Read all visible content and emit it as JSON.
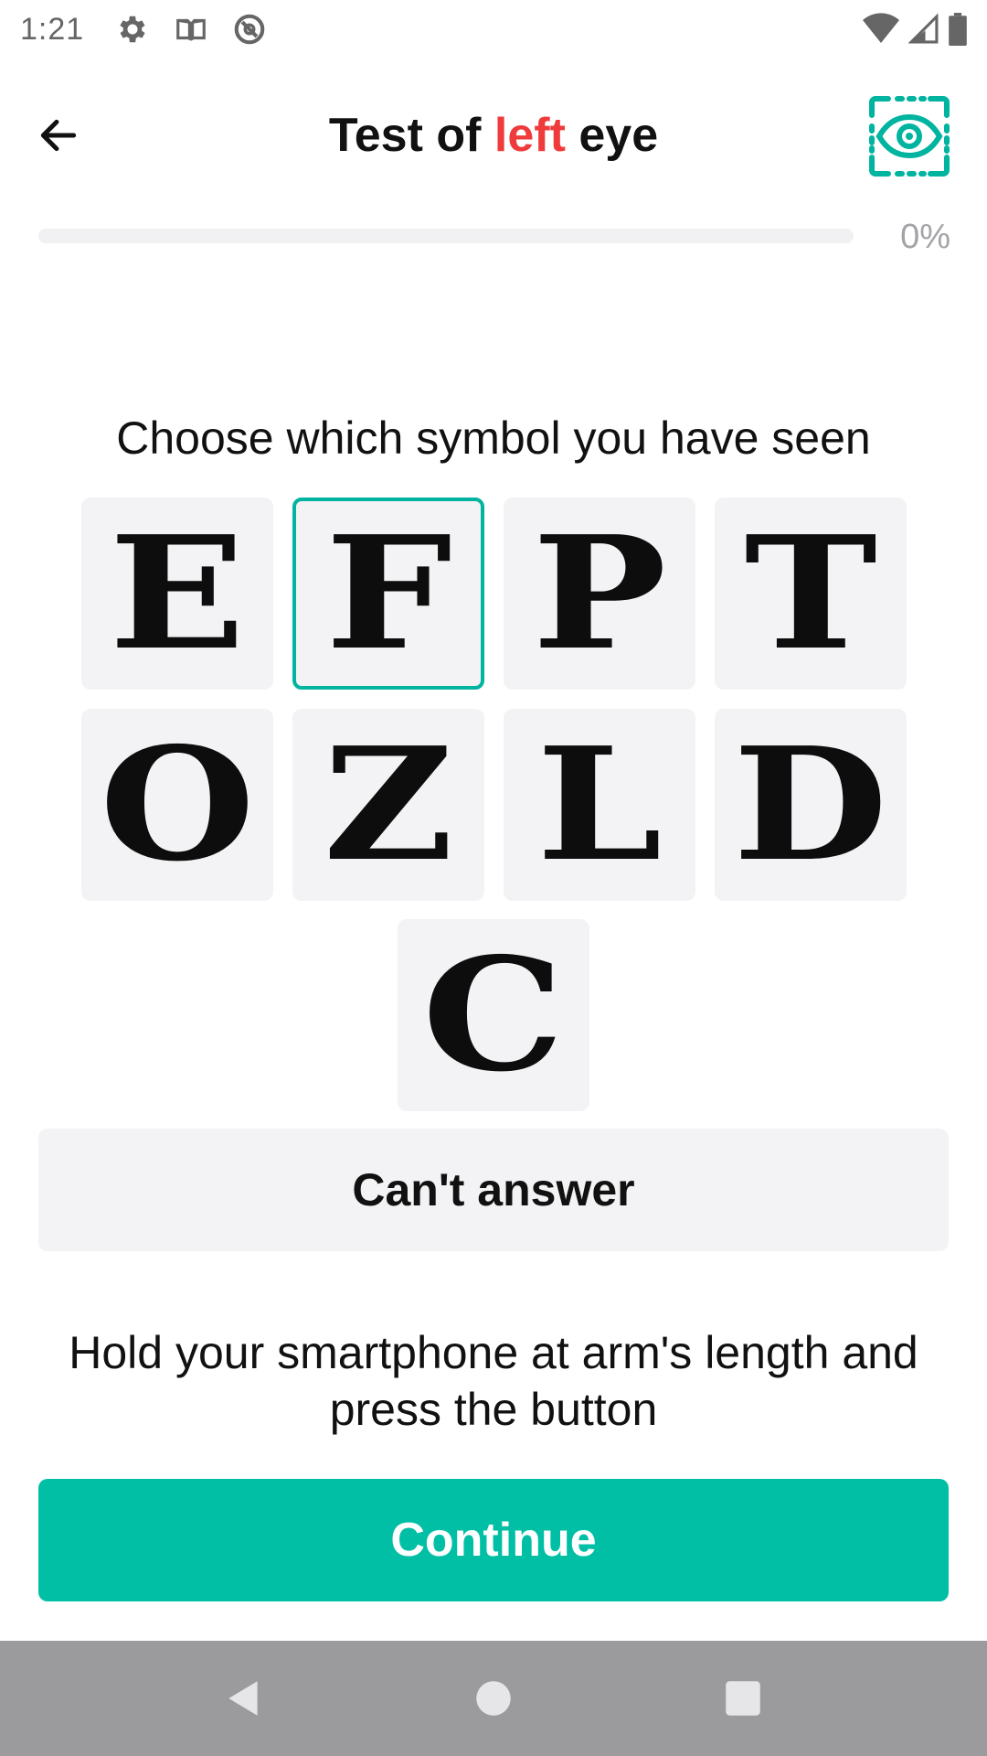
{
  "status_bar": {
    "time": "1:21",
    "left_icons": [
      "gear-icon",
      "book-icon",
      "at-sign-icon"
    ],
    "right_icons": [
      "wifi-icon",
      "signal-icon",
      "battery-icon"
    ]
  },
  "header": {
    "title_prefix": "Test of ",
    "title_accent": "left",
    "title_suffix": " eye",
    "back_icon": "arrow-left-icon",
    "mode_icon": "eye-scan-icon"
  },
  "progress": {
    "value_percent": 0,
    "label": "0%"
  },
  "instruction": "Choose which symbol you have seen",
  "symbols": [
    {
      "letter": "E",
      "selected": false
    },
    {
      "letter": "F",
      "selected": true
    },
    {
      "letter": "P",
      "selected": false
    },
    {
      "letter": "T",
      "selected": false
    },
    {
      "letter": "O",
      "selected": false
    },
    {
      "letter": "Z",
      "selected": false
    },
    {
      "letter": "L",
      "selected": false
    },
    {
      "letter": "D",
      "selected": false
    },
    {
      "letter": "C",
      "selected": false
    }
  ],
  "cant_answer_label": "Can't answer",
  "hint": "Hold your smartphone at arm's length and press the button",
  "continue_label": "Continue",
  "colors": {
    "accent": "#00bfa5",
    "title_accent": "#ef3b3b",
    "tile_bg": "#f3f3f5"
  },
  "nav_bar": {
    "icons": [
      "back-triangle-icon",
      "home-circle-icon",
      "recents-square-icon"
    ]
  }
}
